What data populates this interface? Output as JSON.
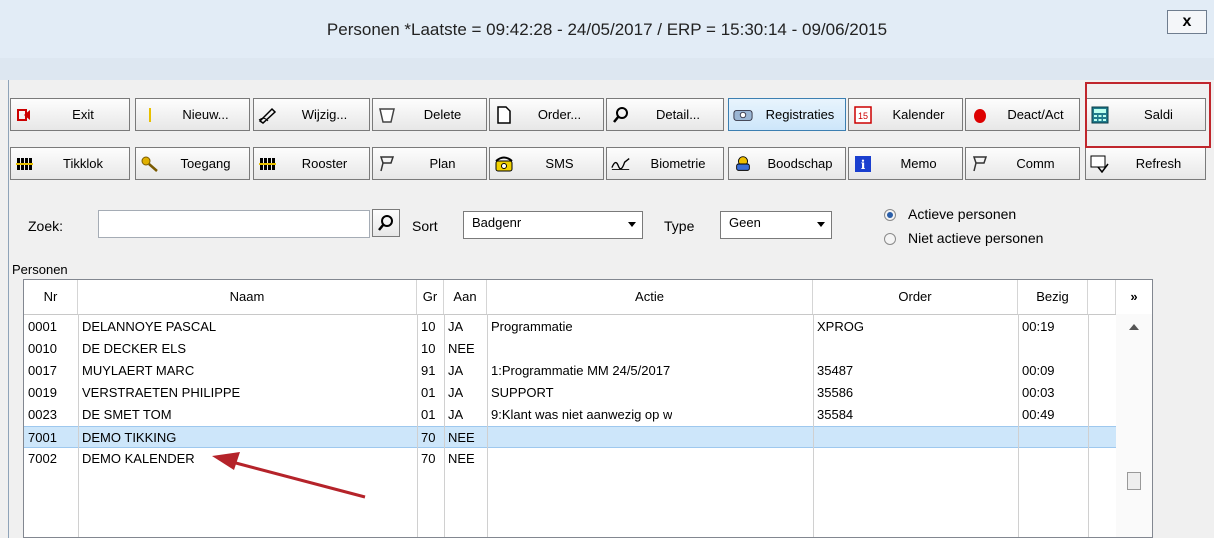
{
  "window": {
    "title": "Personen   *Laatste = 09:42:28 - 24/05/2017 / ERP = 15:30:14 - 09/06/2015",
    "close_label": "x"
  },
  "toolbar": {
    "row1": [
      {
        "label": "Exit",
        "icon": "exit-icon"
      },
      {
        "label": "Nieuw...",
        "icon": "new-icon"
      },
      {
        "label": "Wijzig...",
        "icon": "edit-icon"
      },
      {
        "label": "Delete",
        "icon": "trash-icon"
      },
      {
        "label": "Order...",
        "icon": "document-icon"
      },
      {
        "label": "Detail...",
        "icon": "magnifier-icon"
      },
      {
        "label": "Registraties",
        "icon": "registrations-icon"
      },
      {
        "label": "Kalender",
        "icon": "calendar-icon"
      },
      {
        "label": "Deact/Act",
        "icon": "deactivate-icon"
      },
      {
        "label": "Saldi",
        "icon": "calculator-icon"
      }
    ],
    "row2": [
      {
        "label": "Tikklok",
        "icon": "clock-card-icon"
      },
      {
        "label": "Toegang",
        "icon": "key-icon"
      },
      {
        "label": "Rooster",
        "icon": "schedule-icon"
      },
      {
        "label": "Plan",
        "icon": "plan-icon"
      },
      {
        "label": "SMS",
        "icon": "phone-icon"
      },
      {
        "label": "Biometrie",
        "icon": "signature-icon"
      },
      {
        "label": "Boodschap",
        "icon": "message-icon"
      },
      {
        "label": "Memo",
        "icon": "info-icon"
      },
      {
        "label": "Comm",
        "icon": "comm-icon"
      },
      {
        "label": "Refresh",
        "icon": "refresh-icon"
      }
    ],
    "calendar_day": "15"
  },
  "filters": {
    "search_label": "Zoek:",
    "search_value": "",
    "sort_label": "Sort",
    "sort_value": "Badgenr",
    "type_label": "Type",
    "type_value": "Geen",
    "radio_active": "Actieve personen",
    "radio_inactive": "Niet actieve personen",
    "selected_radio": "Actieve personen"
  },
  "grid": {
    "section_label": "Personen",
    "columns": [
      "Nr",
      "Naam",
      "Gr",
      "Aan",
      "Actie",
      "Order",
      "Bezig"
    ],
    "more_columns_label": "»",
    "rows": [
      {
        "nr": "0001",
        "naam": "DELANNOYE PASCAL",
        "gr": "10",
        "aan": "JA",
        "actie": "Programmatie",
        "order": "XPROG",
        "bezig": "00:19"
      },
      {
        "nr": "0010",
        "naam": "DE DECKER ELS",
        "gr": "10",
        "aan": "NEE",
        "actie": "",
        "order": "",
        "bezig": ""
      },
      {
        "nr": "0017",
        "naam": "MUYLAERT MARC",
        "gr": "91",
        "aan": "JA",
        "actie": "1:Programmatie MM 24/5/2017",
        "order": "35487",
        "bezig": "00:09"
      },
      {
        "nr": "0019",
        "naam": "VERSTRAETEN PHILIPPE",
        "gr": "01",
        "aan": "JA",
        "actie": "SUPPORT",
        "order": "35586",
        "bezig": "00:03"
      },
      {
        "nr": "0023",
        "naam": "DE SMET TOM",
        "gr": "01",
        "aan": "JA",
        "actie": "9:Klant was niet aanwezig op w",
        "order": "35584",
        "bezig": "00:49"
      },
      {
        "nr": "7001",
        "naam": "DEMO TIKKING",
        "gr": "70",
        "aan": "NEE",
        "actie": "",
        "order": "",
        "bezig": ""
      },
      {
        "nr": "7002",
        "naam": "DEMO KALENDER",
        "gr": "70",
        "aan": "NEE",
        "actie": "",
        "order": "",
        "bezig": ""
      }
    ],
    "selected_row": "7001"
  },
  "colors": {
    "highlight_box": "#c0262c",
    "annotation_arrow": "#b5232a",
    "selected_row": "#cde6fa"
  }
}
